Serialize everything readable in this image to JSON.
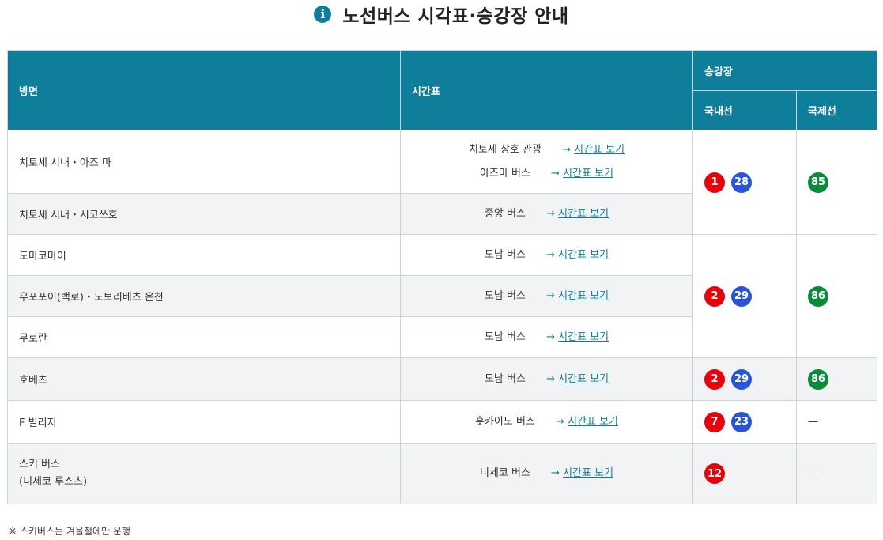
{
  "page": {
    "title": "노선버스 시각표·승강장 안내",
    "info_icon": "i"
  },
  "headers": {
    "direction": "방면",
    "timetable": "시간표",
    "platform": "승강장",
    "domestic": "국내선",
    "international": "국제선"
  },
  "link_arrow": "→",
  "link_label": "시간표 보기",
  "rows": [
    {
      "direction": "치토세 시내・아즈 마",
      "lines": [
        {
          "operator": "치토세 상호 관광"
        },
        {
          "operator": "아즈마 버스"
        }
      ]
    },
    {
      "direction": "치토세 시내・시코쓰호",
      "lines": [
        {
          "operator": "중앙 버스"
        }
      ]
    },
    {
      "direction": "도마코마이",
      "lines": [
        {
          "operator": "도남 버스"
        }
      ]
    },
    {
      "direction": "우포포이(백로)・노보리베츠 온천",
      "lines": [
        {
          "operator": "도남 버스"
        }
      ]
    },
    {
      "direction": "무로란",
      "lines": [
        {
          "operator": "도남 버스"
        }
      ]
    },
    {
      "direction": "호베츠",
      "lines": [
        {
          "operator": "도남 버스"
        }
      ]
    },
    {
      "direction": "F 빌리지",
      "lines": [
        {
          "operator": "홋카이도 버스"
        }
      ]
    },
    {
      "direction_line1": "스키 버스",
      "direction_line2": "(니세코 루스츠)",
      "lines": [
        {
          "operator": "니세코 버스"
        }
      ]
    }
  ],
  "platforms": {
    "group1": {
      "domestic": [
        "1",
        "28"
      ],
      "international": [
        "85"
      ]
    },
    "group2": {
      "domestic": [
        "2",
        "29"
      ],
      "international": [
        "86"
      ]
    },
    "hobetsu": {
      "domestic": [
        "2",
        "29"
      ],
      "international": [
        "86"
      ]
    },
    "fvillage": {
      "domestic": [
        "7",
        "23"
      ],
      "international": "—"
    },
    "ski": {
      "domestic": [
        "12"
      ],
      "international": "—"
    }
  },
  "colors": {
    "header": "#0f7e9b",
    "red": "#e8000b",
    "blue": "#2b54d4",
    "green": "#0b8a3a",
    "alt_row": "#f2f3f5"
  },
  "note": "※ 스키버스는 겨울철에만 운행"
}
